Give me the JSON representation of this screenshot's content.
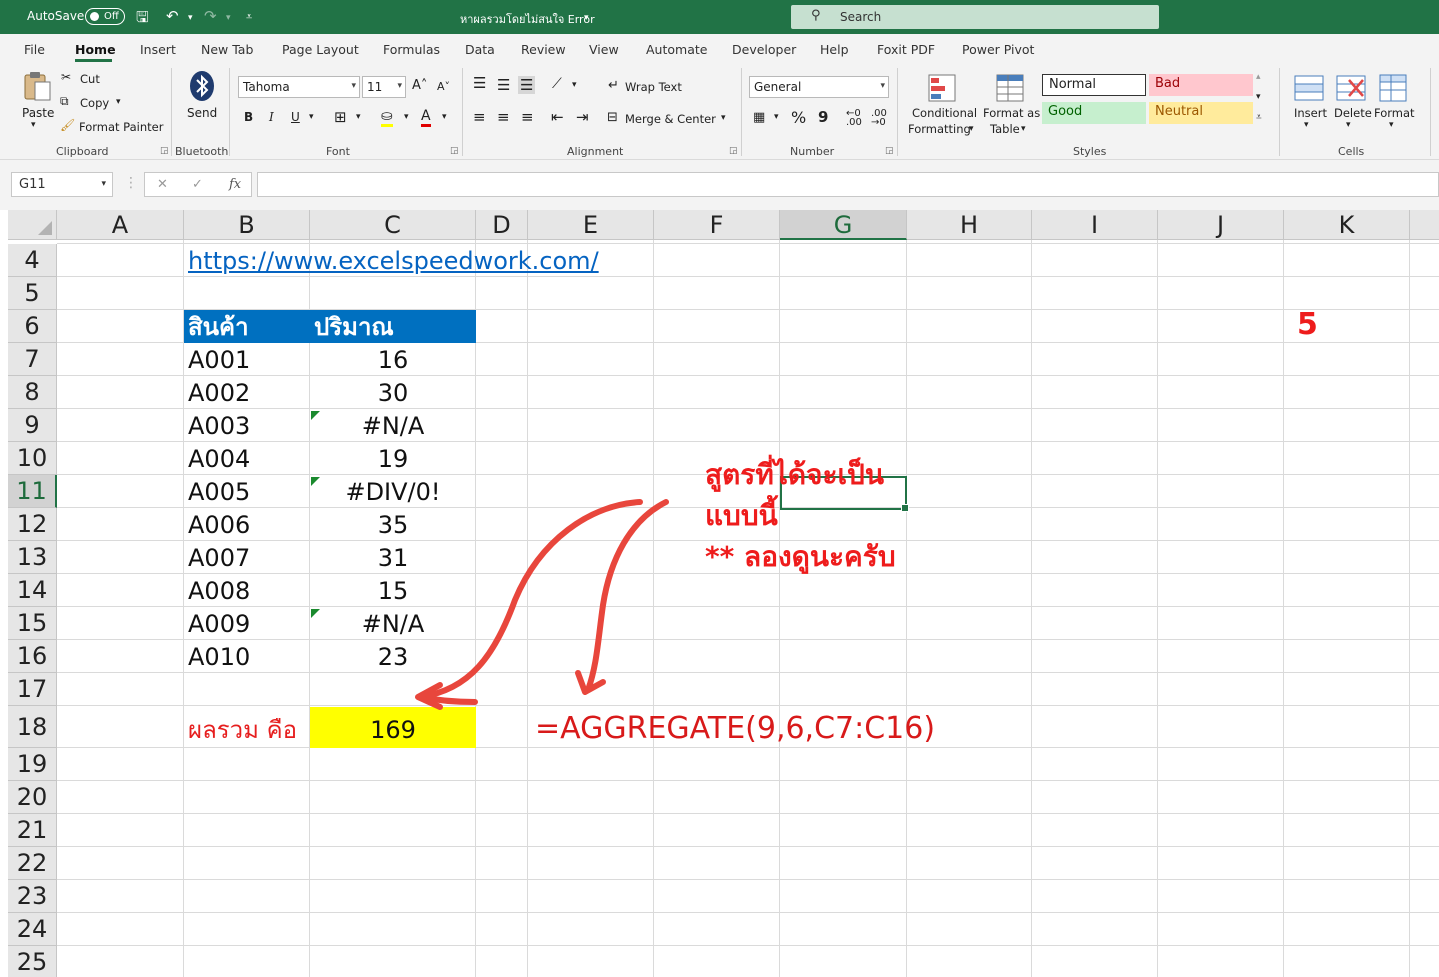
{
  "titlebar": {
    "autosave_label": "AutoSave",
    "autosave_state": "Off",
    "doc_title": "หาผลรวมโดยไม่สนใจ Error",
    "search_placeholder": "Search"
  },
  "tabs": [
    "File",
    "Home",
    "Insert",
    "New Tab",
    "Page Layout",
    "Formulas",
    "Data",
    "Review",
    "View",
    "Automate",
    "Developer",
    "Help",
    "Foxit PDF",
    "Power Pivot"
  ],
  "active_tab": "Home",
  "ribbon": {
    "clipboard": {
      "paste": "Paste",
      "cut": "Cut",
      "copy": "Copy",
      "format_painter": "Format Painter",
      "label": "Clipboard"
    },
    "bluetooth": {
      "send": "Send",
      "label": "Bluetooth"
    },
    "font": {
      "name": "Tahoma",
      "size": "11",
      "bold": "B",
      "italic": "I",
      "underline": "U",
      "label": "Font"
    },
    "alignment": {
      "wrap": "Wrap Text",
      "merge": "Merge & Center",
      "label": "Alignment"
    },
    "number": {
      "format": "General",
      "percent": "%",
      "comma": "9",
      "label": "Number"
    },
    "styles": {
      "conditional": "Conditional",
      "conditional2": "Formatting",
      "format_as": "Format as",
      "format_as2": "Table",
      "normal": "Normal",
      "bad": "Bad",
      "good": "Good",
      "neutral": "Neutral",
      "label": "Styles"
    },
    "cells": {
      "insert": "Insert",
      "delete": "Delete",
      "format": "Format",
      "label": "Cells"
    }
  },
  "formula_bar": {
    "name_box": "G11",
    "formula": ""
  },
  "columns": [
    "A",
    "B",
    "C",
    "D",
    "E",
    "F",
    "G",
    "H",
    "I",
    "J",
    "K"
  ],
  "rows": [
    "4",
    "5",
    "6",
    "7",
    "8",
    "9",
    "10",
    "11",
    "12",
    "13",
    "14",
    "15",
    "16",
    "17",
    "18",
    "19",
    "20",
    "21",
    "22",
    "23",
    "24",
    "25"
  ],
  "selected_cell": {
    "column": "G",
    "row": "11"
  },
  "sheet": {
    "link": "https://www.excelspeedwork.com/",
    "header_product": "สินค้า",
    "header_qty": "ปริมาณ",
    "items": [
      {
        "code": "A001",
        "qty": "16"
      },
      {
        "code": "A002",
        "qty": "30"
      },
      {
        "code": "A003",
        "qty": "#N/A"
      },
      {
        "code": "A004",
        "qty": "19"
      },
      {
        "code": "A005",
        "qty": "#DIV/0!"
      },
      {
        "code": "A006",
        "qty": "35"
      },
      {
        "code": "A007",
        "qty": "31"
      },
      {
        "code": "A008",
        "qty": "15"
      },
      {
        "code": "A009",
        "qty": "#N/A"
      },
      {
        "code": "A010",
        "qty": "23"
      }
    ],
    "total_label": "ผลรวม คือ",
    "total_value": "169",
    "formula_text": "=AGGREGATE(9,6,C7:C16)",
    "k6_value": "5",
    "note_line1": "สูตรที่ได้จะเป็น",
    "note_line2": "แบบนี้",
    "note_line3": "** ลองดูนะครับ"
  },
  "colors": {
    "excel_green": "#217346",
    "header_blue": "#0070c0",
    "highlight_yellow": "#ffff00",
    "annotation_red": "#e8463c",
    "text_red": "#ee1c1c"
  }
}
